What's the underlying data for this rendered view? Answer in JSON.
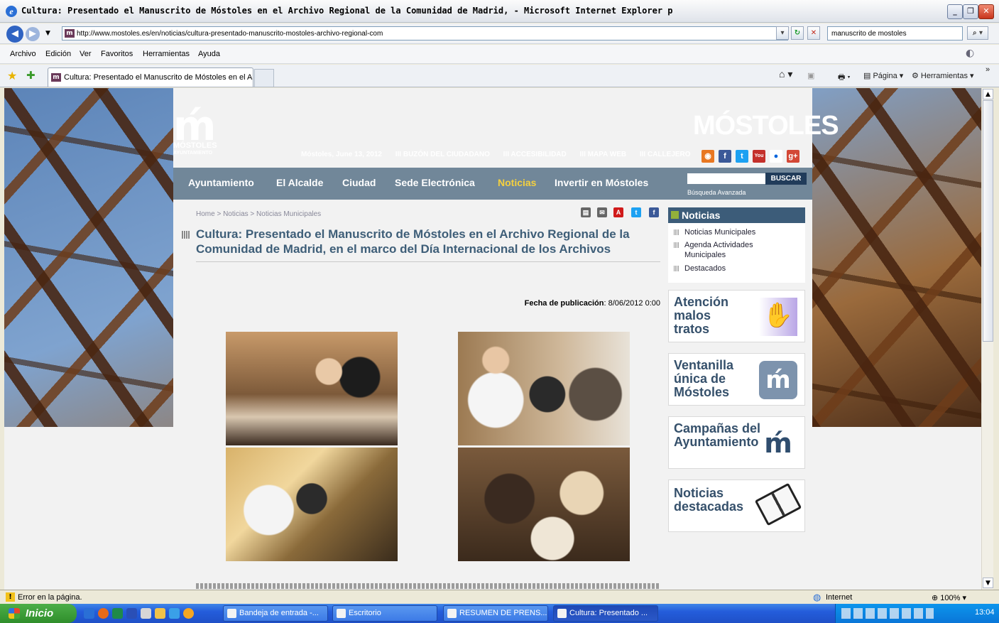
{
  "window": {
    "title": "Cultura: Presentado el Manuscrito de Móstoles en el Archivo Regional de la Comunidad de Madrid, - Microsoft Internet Explorer p"
  },
  "address": {
    "url": "http://www.mostoles.es/en/noticias/cultura-presentado-manuscrito-mostoles-archivo-regional-com",
    "search_value": "manuscrito de mostoles"
  },
  "menu": [
    "Archivo",
    "Edición",
    "Ver",
    "Favoritos",
    "Herramientas",
    "Ayuda"
  ],
  "tab": {
    "label": "Cultura: Presentado el Manuscrito de Móstoles en el A..."
  },
  "toolbar": {
    "pagina": "Página",
    "herramientas": "Herramientas"
  },
  "site": {
    "logo_line1": "MÓSTOLES",
    "logo_line2": "AYUNTAMIENTO",
    "brand": "MÓSTOLES",
    "date": "Móstoles, June 13, 2012",
    "links": [
      "III BUZÓN DEL CIUDADANO",
      "III ACCESIBILIDAD",
      "III MAPA WEB",
      "III CALLEJERO"
    ],
    "nav": [
      "Ayuntamiento",
      "El Alcalde",
      "Ciudad",
      "Sede Electrónica",
      "Noticias",
      "Invertir en Móstoles"
    ],
    "search_button": "BUSCAR",
    "advanced_search": "Búsqueda Avanzada"
  },
  "article": {
    "breadcrumb": "Home > Noticias > Noticias Municipales",
    "title": "Cultura: Presentado el Manuscrito de Móstoles en el Archivo Regional de la Comunidad de Madrid, en el marco del Día Internacional de los Archivos",
    "pub_label": "Fecha de publicación",
    "pub_date": ": 8/06/2012 0:00"
  },
  "sidebar": {
    "heading": "Noticias",
    "items": [
      "Noticias Municipales",
      "Agenda Actividades Municipales",
      "Destacados"
    ],
    "banners": [
      "Atención malos tratos",
      "Ventanilla única de Móstoles",
      "Campañas del Ayuntamiento",
      "Noticias destacadas"
    ]
  },
  "status": {
    "message": "Error en la página.",
    "zone": "Internet",
    "zoom": "100%"
  },
  "taskbar": {
    "start": "Inicio",
    "tasks": [
      "Bandeja de entrada -...",
      "Escritorio",
      "RESUMEN DE PRENS...",
      "Cultura: Presentado ..."
    ],
    "clock": "13:04"
  },
  "colors": {
    "nav_highlight": "#f4d03f",
    "title_blue": "#3e5e78",
    "sidebar_head": "#3c5c79"
  }
}
